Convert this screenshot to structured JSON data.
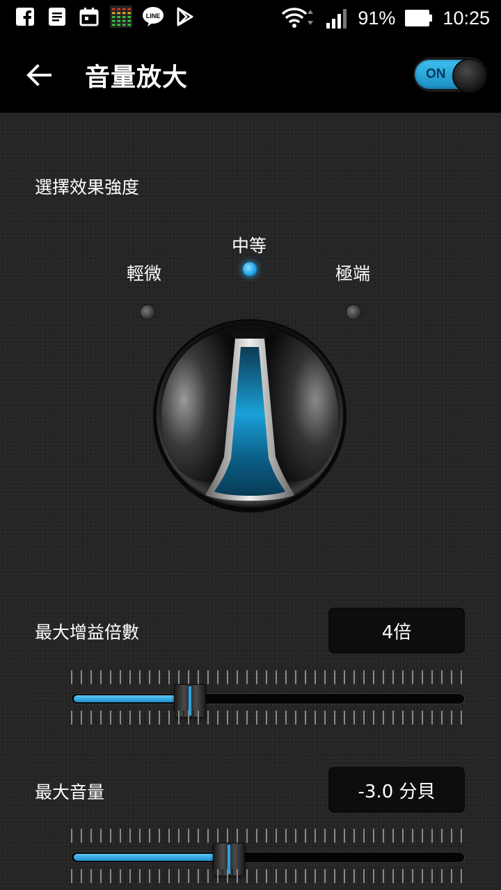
{
  "status_bar": {
    "battery_percent": "91%",
    "time": "10:25",
    "notification_icons": [
      "facebook-icon",
      "document-icon",
      "calendar-icon",
      "equalizer-icon",
      "line-icon",
      "play-store-icon"
    ]
  },
  "app_bar": {
    "title": "音量放大",
    "toggle_label": "ON",
    "toggle_on": true
  },
  "intensity": {
    "label": "選擇效果強度",
    "options": [
      "輕微",
      "中等",
      "極端"
    ],
    "selected": "中等"
  },
  "max_gain": {
    "label": "最大增益倍數",
    "value": "4倍",
    "slider_fraction": 0.3
  },
  "max_volume": {
    "label": "最大音量",
    "value": "-3.0 分貝",
    "slider_fraction": 0.4
  },
  "colors": {
    "accent": "#22A7EA",
    "background": "#262626",
    "bar": "#000000"
  }
}
